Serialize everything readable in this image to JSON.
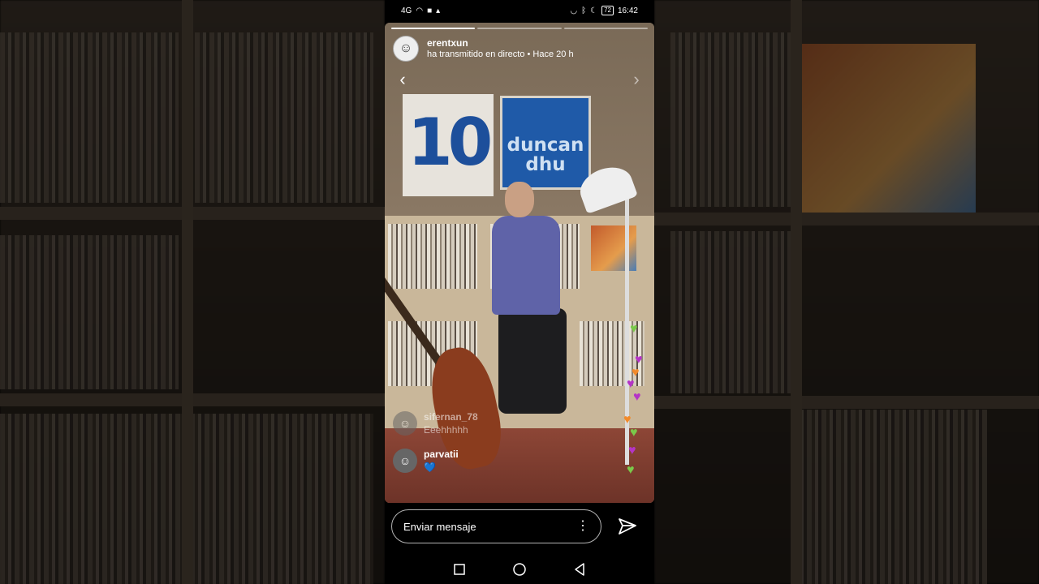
{
  "status_bar": {
    "left_signal": "4G",
    "time": "16:42",
    "battery": "72"
  },
  "story": {
    "username": "erentxun",
    "subtitle": "ha transmitido en directo • Hace 20 h",
    "progress": {
      "segments": 3,
      "active_index": 0
    }
  },
  "video_content": {
    "poster_number": "10",
    "poster_duncan": "duncan\ndhu"
  },
  "comments": [
    {
      "user": "sifernan_78",
      "text": "Eeehhhhh",
      "faded": true
    },
    {
      "user": "parvatii",
      "text": "💙",
      "faded": false
    }
  ],
  "hearts": [
    "#7ac94a",
    "#b534c7",
    "#f28a2a",
    "#b534c7",
    "#b534c7",
    "#f28a2a",
    "#7ac94a",
    "#b534c7",
    "#7ac94a"
  ],
  "composer": {
    "placeholder": "Enviar mensaje"
  },
  "icons": {
    "back": "chevron-left-icon",
    "next": "chevron-right-icon",
    "more": "more-vertical-icon",
    "send": "send-icon",
    "nav_recent": "square-icon",
    "nav_home": "circle-icon",
    "nav_back": "triangle-back-icon"
  }
}
